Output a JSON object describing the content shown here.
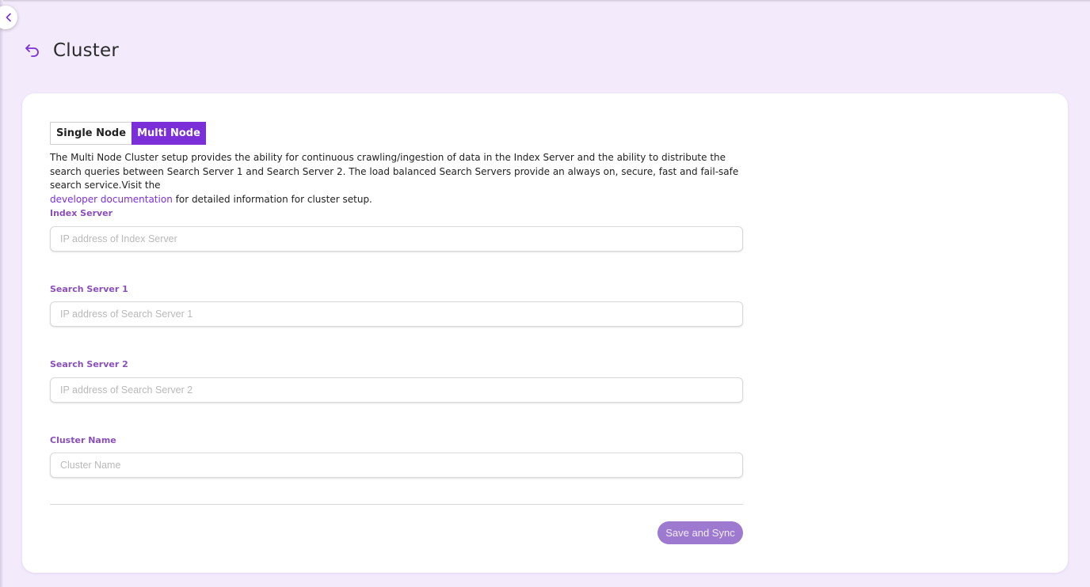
{
  "page": {
    "title": "Cluster",
    "accent_color": "#7b2fd9",
    "label_color": "#8a4fb8",
    "background_color": "#f3eafc"
  },
  "icons": {
    "collapse": "chevron-left-icon",
    "back": "undo-arrow-icon"
  },
  "mode_toggle": {
    "options": [
      "Single Node",
      "Multi Node"
    ],
    "selected": "Multi Node"
  },
  "description": {
    "text_before_link": "The Multi Node Cluster setup provides the ability for continuous crawling/ingestion of data in the Index Server and the ability to distribute the search queries between Search Server 1 and Search Server 2. The load balanced Search Servers provide an always on, secure, fast and fail-safe search service.Visit the",
    "link_text": "developer documentation",
    "text_after_link": "for detailed information for cluster setup."
  },
  "form": {
    "fields": [
      {
        "label": "Index Server",
        "placeholder": "IP address of Index Server",
        "value": ""
      },
      {
        "label": "Search Server 1",
        "placeholder": "IP address of Search Server 1",
        "value": ""
      },
      {
        "label": "Search Server 2",
        "placeholder": "IP address of Search Server 2",
        "value": ""
      },
      {
        "label": "Cluster Name",
        "placeholder": "Cluster Name",
        "value": ""
      }
    ],
    "submit_label": "Save and Sync"
  }
}
